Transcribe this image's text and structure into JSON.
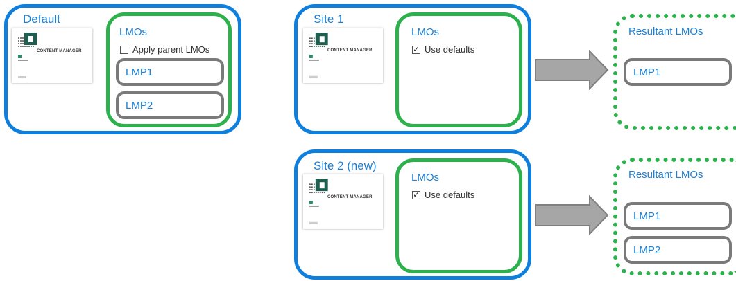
{
  "colors": {
    "site_border": "#0f7fde",
    "lmo_border": "#2db14c",
    "lmp_border": "#7a7a7a",
    "text_blue": "#1a7fd6",
    "arrow_fill": "#a6a6a6"
  },
  "logo": {
    "text": "CONTENT MANAGER",
    "icon": "content-manager-logo"
  },
  "default_site": {
    "title": "Default",
    "lmos_title": "LMOs",
    "checkbox_label": "Apply parent LMOs",
    "checkbox_checked": false,
    "lmps": [
      "LMP1",
      "LMP2"
    ]
  },
  "site1": {
    "title": "Site 1",
    "lmos_title": "LMOs",
    "checkbox_label": "Use defaults",
    "checkbox_checked": true
  },
  "site2": {
    "title": "Site 2 (new)",
    "lmos_title": "LMOs",
    "checkbox_label": "Use defaults",
    "checkbox_checked": true
  },
  "result1": {
    "title": "Resultant LMOs",
    "lmps": [
      "LMP1"
    ]
  },
  "result2": {
    "title": "Resultant LMOs",
    "lmps": [
      "LMP1",
      "LMP2"
    ]
  }
}
